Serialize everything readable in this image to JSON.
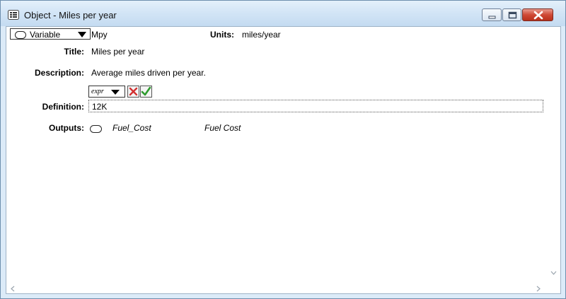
{
  "window": {
    "title": "Object - Miles per year"
  },
  "object": {
    "class": "Variable",
    "identifier": "Mpy",
    "units_label": "Units:",
    "units": "miles/year",
    "title_label": "Title:",
    "title": "Miles per year",
    "description_label": "Description:",
    "description": "Average miles driven per year.",
    "definition_label": "Definition:",
    "definition_type": "expr",
    "definition": "12K",
    "outputs_label": "Outputs:",
    "outputs": [
      {
        "identifier": "Fuel_Cost",
        "title": "Fuel Cost"
      }
    ]
  },
  "colors": {
    "accent_red": "#d32f2f",
    "accent_green": "#2e9b2e",
    "title_bg": "#d3e5f6"
  },
  "icons": [
    "window-app-icon",
    "minimize-icon",
    "maximize-icon",
    "close-icon",
    "variable-oval-icon",
    "dropdown-arrow-icon",
    "cancel-x-icon",
    "accept-check-icon",
    "scroll-down-icon",
    "scroll-left-icon",
    "scroll-right-icon"
  ]
}
